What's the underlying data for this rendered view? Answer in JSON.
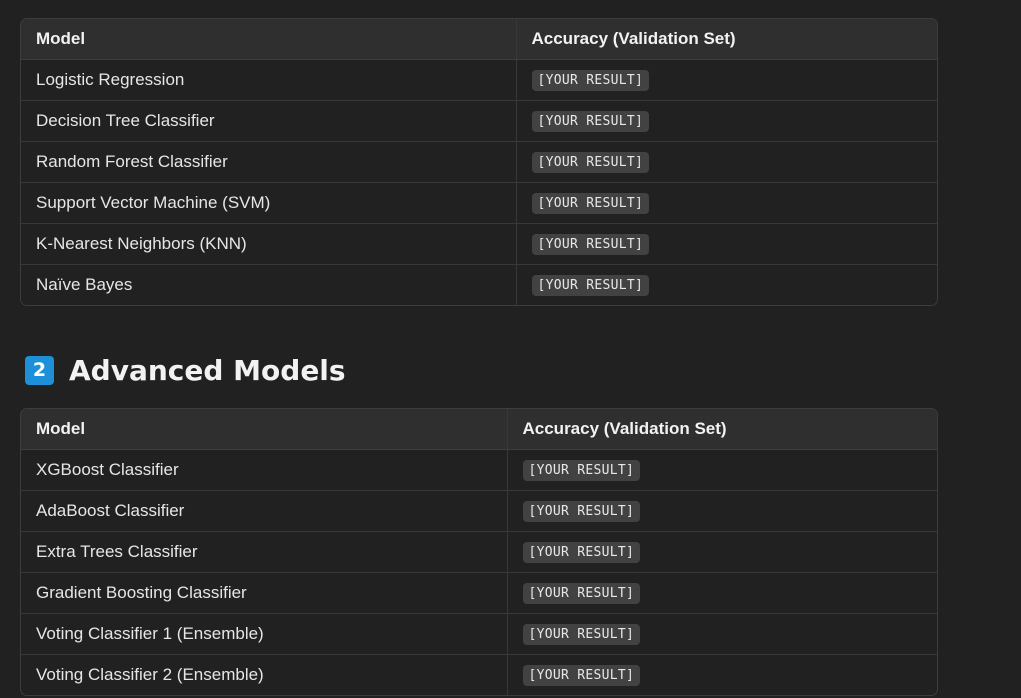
{
  "table1": {
    "headers": [
      "Model",
      "Accuracy (Validation Set)"
    ],
    "rows": [
      {
        "model": "Logistic Regression",
        "accuracy": "[YOUR RESULT]"
      },
      {
        "model": "Decision Tree Classifier",
        "accuracy": "[YOUR RESULT]"
      },
      {
        "model": "Random Forest Classifier",
        "accuracy": "[YOUR RESULT]"
      },
      {
        "model": "Support Vector Machine (SVM)",
        "accuracy": "[YOUR RESULT]"
      },
      {
        "model": "K-Nearest Neighbors (KNN)",
        "accuracy": "[YOUR RESULT]"
      },
      {
        "model": "Naïve Bayes",
        "accuracy": "[YOUR RESULT]"
      }
    ]
  },
  "section2": {
    "badge": "2",
    "title": "Advanced Models",
    "badge_color": "#1e90d8"
  },
  "table2": {
    "headers": [
      "Model",
      "Accuracy (Validation Set)"
    ],
    "rows": [
      {
        "model": "XGBoost Classifier",
        "accuracy": "[YOUR RESULT]"
      },
      {
        "model": "AdaBoost Classifier",
        "accuracy": "[YOUR RESULT]"
      },
      {
        "model": "Extra Trees Classifier",
        "accuracy": "[YOUR RESULT]"
      },
      {
        "model": "Gradient Boosting Classifier",
        "accuracy": "[YOUR RESULT]"
      },
      {
        "model": "Voting Classifier 1 (Ensemble)",
        "accuracy": "[YOUR RESULT]"
      },
      {
        "model": "Voting Classifier 2 (Ensemble)",
        "accuracy": "[YOUR RESULT]"
      }
    ]
  }
}
